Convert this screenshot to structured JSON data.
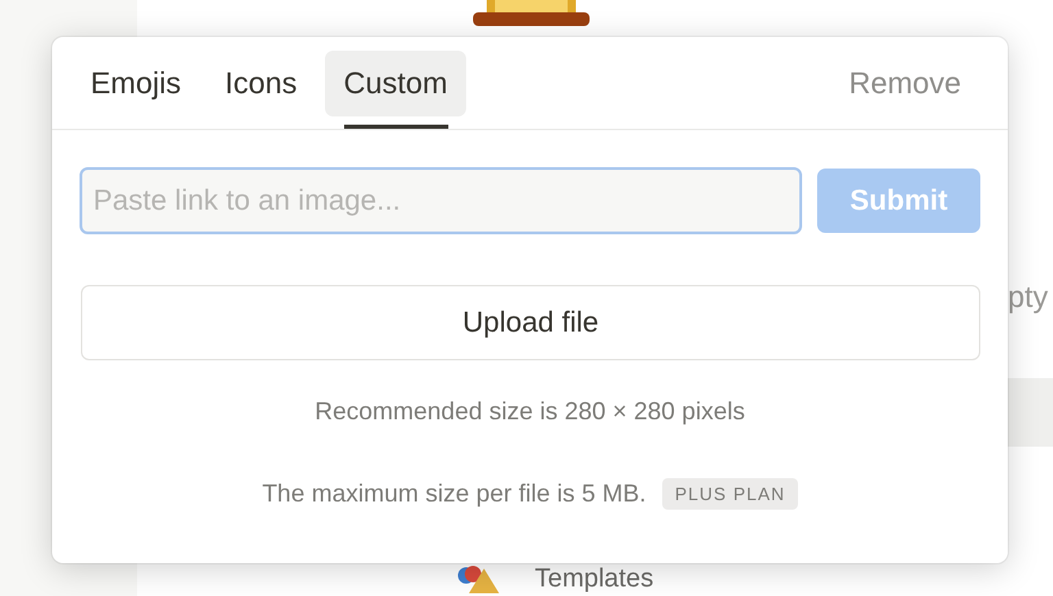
{
  "background": {
    "side_text": "pty",
    "templates_label": "Templates"
  },
  "picker": {
    "tabs": [
      {
        "label": "Emojis",
        "selected": false
      },
      {
        "label": "Icons",
        "selected": false
      },
      {
        "label": "Custom",
        "selected": true
      }
    ],
    "remove_label": "Remove",
    "link_field": {
      "placeholder": "Paste link to an image..."
    },
    "submit": {
      "label": "Submit",
      "disabled": true
    },
    "upload_label": "Upload file",
    "recommendation": "Recommended size is 280 × 280 pixels",
    "max_size": "The maximum size per file is 5 MB.",
    "plan_badge": "PLUS PLAN"
  }
}
